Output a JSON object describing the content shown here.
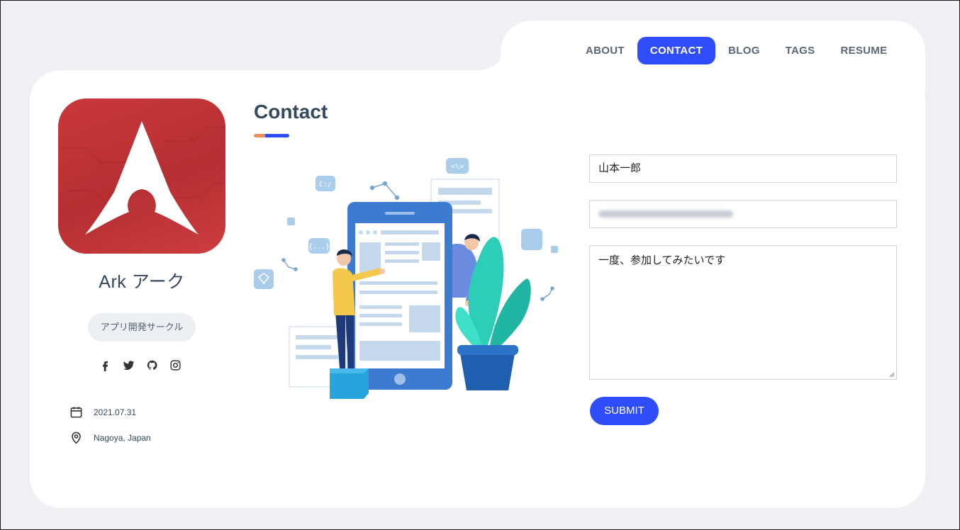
{
  "nav": {
    "items": [
      {
        "label": "ABOUT",
        "active": false
      },
      {
        "label": "CONTACT",
        "active": true
      },
      {
        "label": "BLOG",
        "active": false
      },
      {
        "label": "TAGS",
        "active": false
      },
      {
        "label": "RESUME",
        "active": false
      }
    ]
  },
  "profile": {
    "name": "Ark アーク",
    "role": "アプリ開発サークル",
    "socials": [
      "facebook-icon",
      "twitter-icon",
      "github-icon",
      "instagram-icon"
    ],
    "date": "2021.07.31",
    "location": "Nagoya, Japan"
  },
  "page": {
    "title": "Contact"
  },
  "form": {
    "name_value": "山本一郎",
    "message_value": "一度、参加してみたいです",
    "submit_label": "SUBMIT"
  },
  "colors": {
    "accent": "#2f4dfb",
    "logo_red": "#c0353a",
    "underline_orange": "#f08c5a",
    "page_bg": "#eef0f4"
  }
}
